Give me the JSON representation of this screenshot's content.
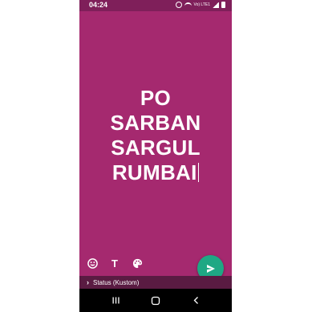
{
  "statusbar": {
    "time": "04:24",
    "icons": [
      "alarm-icon",
      "wifi-icon",
      "volte-icon",
      "signal-icon",
      "battery-icon"
    ],
    "volte_label": "Vo) LTE1"
  },
  "editor": {
    "background_color": "#a5296f",
    "text_lines": [
      "PO",
      "SARBAN",
      "SARGUL",
      "RUMBAI"
    ],
    "tools": [
      "emoji-icon",
      "text-font-icon",
      "palette-icon"
    ],
    "text_tool_label": "T"
  },
  "footer": {
    "audience_label": "Status (Kustom)"
  },
  "colors": {
    "accent": "#1fa884",
    "statusbar": "#7f1f5a",
    "footer": "#5a1b42"
  }
}
